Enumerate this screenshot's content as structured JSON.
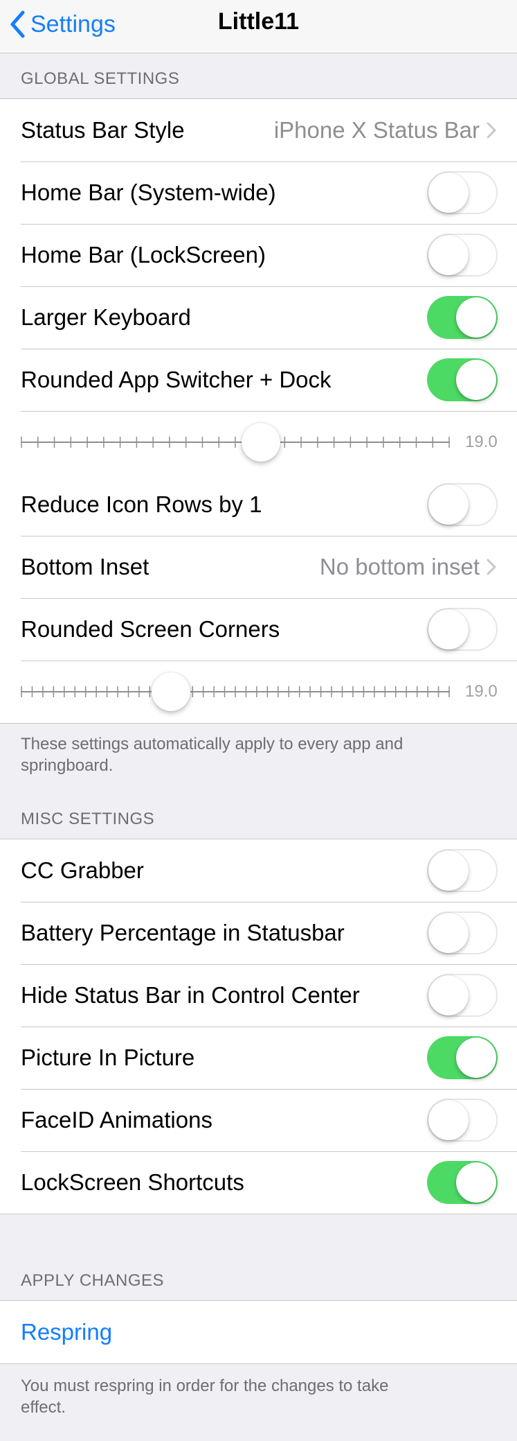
{
  "nav": {
    "back_label": "Settings",
    "title": "Little11"
  },
  "global": {
    "header": "GLOBAL SETTINGS",
    "status_bar_style": {
      "label": "Status Bar Style",
      "value": "iPhone X Status Bar"
    },
    "home_bar_system": {
      "label": "Home Bar (System-wide)",
      "on": false
    },
    "home_bar_lock": {
      "label": "Home Bar (LockScreen)",
      "on": false
    },
    "larger_keyboard": {
      "label": "Larger Keyboard",
      "on": true
    },
    "rounded_switcher": {
      "label": "Rounded App Switcher + Dock",
      "on": true
    },
    "slider1": {
      "value_label": "19.0",
      "fraction": 0.56
    },
    "reduce_icon_rows": {
      "label": "Reduce Icon Rows by 1",
      "on": false
    },
    "bottom_inset": {
      "label": "Bottom Inset",
      "value": "No bottom inset"
    },
    "rounded_corners": {
      "label": "Rounded Screen Corners",
      "on": false
    },
    "slider2": {
      "value_label": "19.0",
      "fraction": 0.35
    },
    "footer": "These settings automatically apply to every app and springboard."
  },
  "misc": {
    "header": "MISC SETTINGS",
    "cc_grabber": {
      "label": "CC Grabber",
      "on": false
    },
    "battery_percentage": {
      "label": "Battery Percentage in Statusbar",
      "on": false
    },
    "hide_status_cc": {
      "label": "Hide Status Bar in Control Center",
      "on": false
    },
    "pip": {
      "label": "Picture In Picture",
      "on": true
    },
    "faceid_anim": {
      "label": "FaceID Animations",
      "on": false
    },
    "lock_shortcuts": {
      "label": "LockScreen Shortcuts",
      "on": true
    }
  },
  "apply": {
    "header": "APPLY CHANGES",
    "respring_label": "Respring",
    "footer": "You must respring in order for the changes to take effect."
  },
  "colors": {
    "accent": "#147efb",
    "toggle_on": "#4cd964",
    "background": "#efeff4"
  },
  "icons": {
    "back": "chevron-left-icon",
    "disclosure": "chevron-right-icon"
  }
}
